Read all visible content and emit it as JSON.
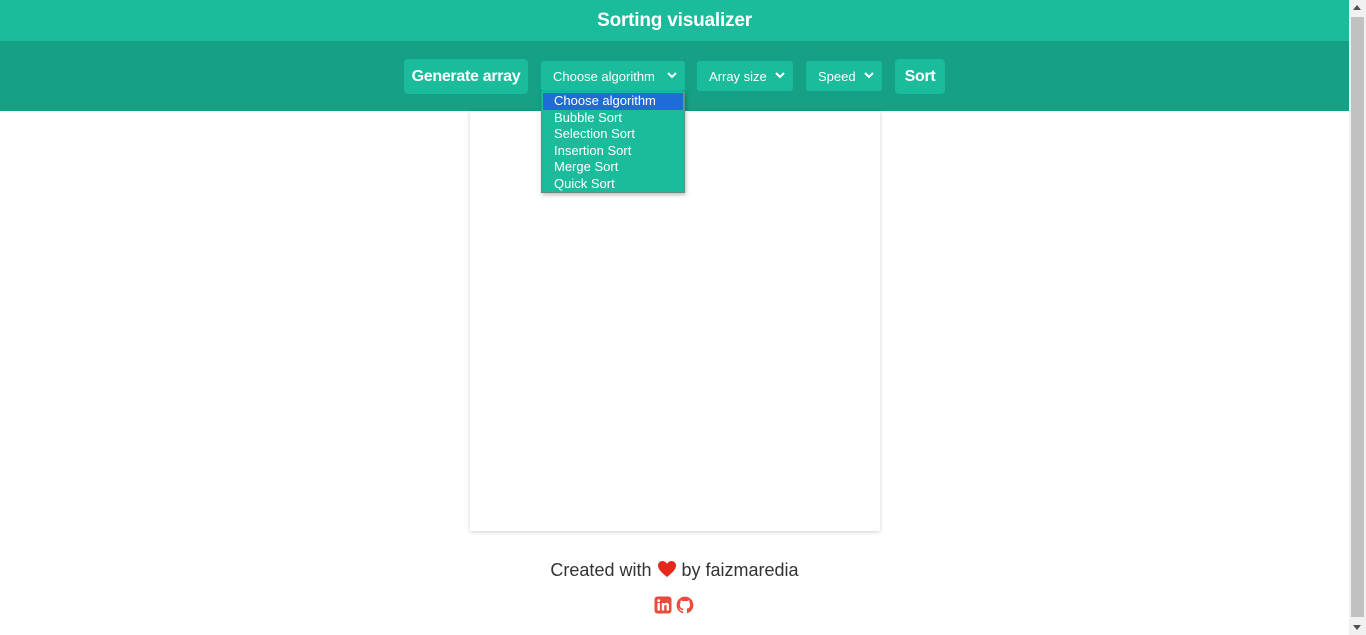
{
  "header": {
    "title": "Sorting visualizer"
  },
  "toolbar": {
    "generate_label": "Generate array",
    "algorithm_select": {
      "selected": "Choose algorithm",
      "options": [
        "Choose algorithm",
        "Bubble Sort",
        "Selection Sort",
        "Insertion Sort",
        "Merge Sort",
        "Quick Sort"
      ]
    },
    "size_select": {
      "selected": "Array size"
    },
    "speed_select": {
      "selected": "Speed"
    },
    "sort_label": "Sort"
  },
  "footer": {
    "prefix": "Created with",
    "suffix": "by faizmaredia",
    "icons": [
      "heart-icon",
      "linkedin-icon",
      "github-icon"
    ]
  },
  "colors": {
    "header_bg": "#1abc9c",
    "toolbar_bg": "#16a085",
    "control_bg": "#1abc9c",
    "selected_option": "#1e6cd6",
    "icon_accent": "#e74c3c"
  }
}
